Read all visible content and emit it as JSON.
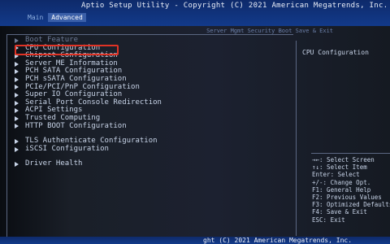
{
  "title": "Aptio Setup Utility - Copyright (C) 2021 American Megatrends, Inc.",
  "tabs": [
    {
      "label": "Main",
      "active": false
    },
    {
      "label": "Advanced",
      "active": true
    }
  ],
  "tabs_right": "Server Mgmt   Security   Boot   Save & Exit",
  "menu_items": [
    {
      "label": "Boot Feature"
    },
    {
      "label": "CPU Configuration"
    },
    {
      "label": "Chipset Configuration"
    },
    {
      "label": "Server ME Information"
    },
    {
      "label": "PCH SATA Configuration"
    },
    {
      "label": "PCH sSATA Configuration"
    },
    {
      "label": "PCIe/PCI/PnP Configuration"
    },
    {
      "label": "Super IO Configuration"
    },
    {
      "label": "Serial Port Console Redirection"
    },
    {
      "label": "ACPI Settings"
    },
    {
      "label": "Trusted Computing"
    },
    {
      "label": "HTTP BOOT Configuration"
    },
    {
      "label": "TLS Authenticate Configuration"
    },
    {
      "label": "iSCSI Configuration"
    },
    {
      "label": "Driver Health"
    }
  ],
  "help_text": "CPU Configuration",
  "keys": [
    "→←: Select Screen",
    "↑↓: Select Item",
    "Enter: Select",
    "+/-: Change Opt.",
    "F1: General Help",
    "F2: Previous Values",
    "F3: Optimized Defaults",
    "F4: Save & Exit",
    "ESC: Exit"
  ],
  "footer": "ght (C) 2021 American Megatrends, Inc.",
  "colors": {
    "accent_blue": "#123a8a",
    "highlight_red": "#e03325",
    "text": "#c8d4e8"
  }
}
